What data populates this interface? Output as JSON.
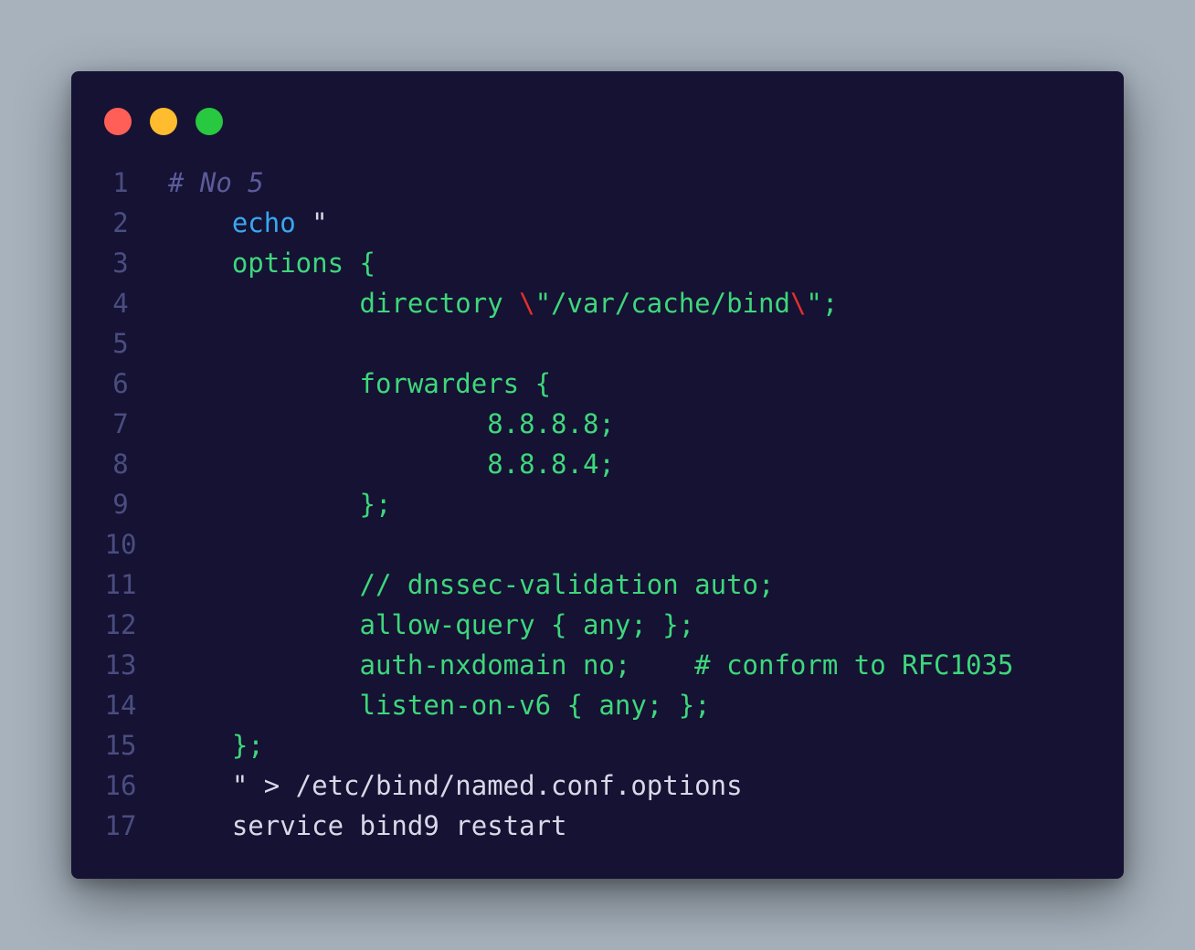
{
  "window": {
    "traffic_lights": [
      {
        "name": "close",
        "color": "#ff5f57"
      },
      {
        "name": "minimize",
        "color": "#febc2e"
      },
      {
        "name": "maximize",
        "color": "#28c840"
      }
    ]
  },
  "colors": {
    "background": "#a7b2bd",
    "editor_background": "#151233",
    "line_number": "#4a4d80",
    "comment": "#5b5b9a",
    "keyword": "#38a8f0",
    "string": "#3ed77b",
    "escape": "#e2302c",
    "plain": "#d8d8e8"
  },
  "code_lines": [
    {
      "number": "1",
      "tokens": [
        {
          "text": "# No 5",
          "type": "comment"
        }
      ]
    },
    {
      "number": "2",
      "tokens": [
        {
          "text": "    ",
          "type": "plain"
        },
        {
          "text": "echo",
          "type": "keyword"
        },
        {
          "text": " \"",
          "type": "plain"
        }
      ]
    },
    {
      "number": "3",
      "tokens": [
        {
          "text": "    options {",
          "type": "string"
        }
      ]
    },
    {
      "number": "4",
      "tokens": [
        {
          "text": "            directory ",
          "type": "string"
        },
        {
          "text": "\\",
          "type": "escape"
        },
        {
          "text": "\"/var/cache/bind",
          "type": "string"
        },
        {
          "text": "\\",
          "type": "escape"
        },
        {
          "text": "\";",
          "type": "string"
        }
      ]
    },
    {
      "number": "5",
      "tokens": []
    },
    {
      "number": "6",
      "tokens": [
        {
          "text": "            forwarders {",
          "type": "string"
        }
      ]
    },
    {
      "number": "7",
      "tokens": [
        {
          "text": "                    8.8.8.8;",
          "type": "string"
        }
      ]
    },
    {
      "number": "8",
      "tokens": [
        {
          "text": "                    8.8.8.4;",
          "type": "string"
        }
      ]
    },
    {
      "number": "9",
      "tokens": [
        {
          "text": "            };",
          "type": "string"
        }
      ]
    },
    {
      "number": "10",
      "tokens": []
    },
    {
      "number": "11",
      "tokens": [
        {
          "text": "            // dnssec-validation auto;",
          "type": "string"
        }
      ]
    },
    {
      "number": "12",
      "tokens": [
        {
          "text": "            allow-query { any; };",
          "type": "string"
        }
      ]
    },
    {
      "number": "13",
      "tokens": [
        {
          "text": "            auth-nxdomain no;    # conform to RFC1035",
          "type": "string"
        }
      ]
    },
    {
      "number": "14",
      "tokens": [
        {
          "text": "            listen-on-v6 { any; };",
          "type": "string"
        }
      ]
    },
    {
      "number": "15",
      "tokens": [
        {
          "text": "    };",
          "type": "string"
        }
      ]
    },
    {
      "number": "16",
      "tokens": [
        {
          "text": "    \" > /etc/bind/named.conf.options",
          "type": "plain"
        }
      ]
    },
    {
      "number": "17",
      "tokens": [
        {
          "text": "    service bind9 restart",
          "type": "plain"
        }
      ]
    }
  ]
}
